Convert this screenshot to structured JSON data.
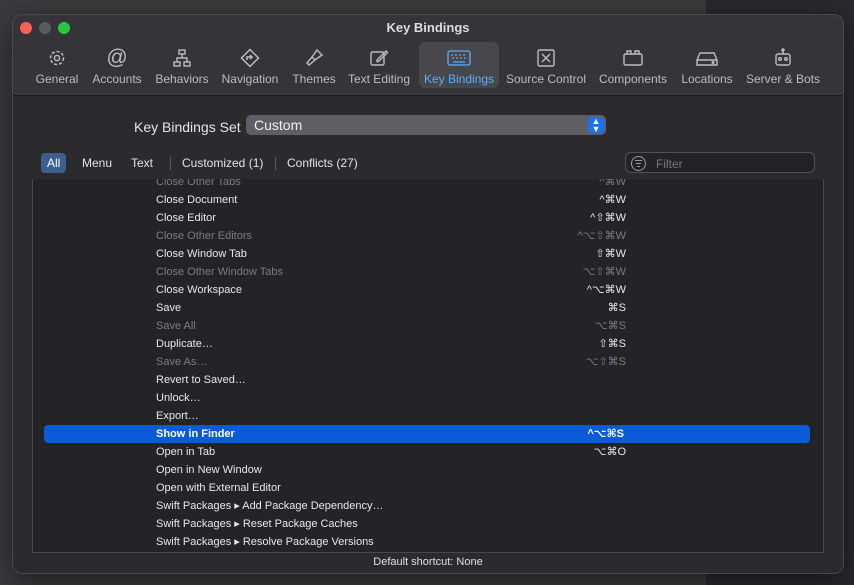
{
  "window": {
    "title": "Key Bindings"
  },
  "toolbar": {
    "tabs": [
      {
        "label": "General",
        "icon": "gear-icon"
      },
      {
        "label": "Accounts",
        "icon": "at-icon"
      },
      {
        "label": "Behaviors",
        "icon": "hierarchy-icon"
      },
      {
        "label": "Navigation",
        "icon": "navigation-diamond-icon"
      },
      {
        "label": "Themes",
        "icon": "paintbrush-icon"
      },
      {
        "label": "Text Editing",
        "icon": "pencil-square-icon"
      },
      {
        "label": "Key Bindings",
        "icon": "keyboard-icon",
        "active": true
      },
      {
        "label": "Source Control",
        "icon": "source-control-icon"
      },
      {
        "label": "Components",
        "icon": "components-box-icon"
      },
      {
        "label": "Locations",
        "icon": "drive-icon"
      },
      {
        "label": "Server & Bots",
        "icon": "robot-icon"
      }
    ]
  },
  "key_bindings_set": {
    "label": "Key Bindings Set",
    "value": "Custom"
  },
  "filter_tabs": {
    "all": "All",
    "menu": "Menu",
    "text": "Text",
    "customized": "Customized (1)",
    "conflicts": "Conflicts (27)"
  },
  "filter": {
    "placeholder": "Filter"
  },
  "bindings": [
    {
      "command": "Close Other Tabs",
      "shortcut": "^⌘W",
      "dim": true
    },
    {
      "command": "Close Document",
      "shortcut": "^⌘W"
    },
    {
      "command": "Close Editor",
      "shortcut": "^⇧⌘W"
    },
    {
      "command": "Close Other Editors",
      "shortcut": "^⌥⇧⌘W",
      "dim": true
    },
    {
      "command": "Close Window Tab",
      "shortcut": "⇧⌘W"
    },
    {
      "command": "Close Other Window Tabs",
      "shortcut": "⌥⇧⌘W",
      "dim": true
    },
    {
      "command": "Close Workspace",
      "shortcut": "^⌥⌘W"
    },
    {
      "command": "Save",
      "shortcut": "⌘S"
    },
    {
      "command": "Save All",
      "shortcut": "⌥⌘S",
      "dim": true
    },
    {
      "command": "Duplicate…",
      "shortcut": "⇧⌘S"
    },
    {
      "command": "Save As…",
      "shortcut": "⌥⇧⌘S",
      "dim": true
    },
    {
      "command": "Revert to Saved…",
      "shortcut": ""
    },
    {
      "command": "Unlock…",
      "shortcut": ""
    },
    {
      "command": "Export…",
      "shortcut": ""
    },
    {
      "command": "Show in Finder",
      "shortcut": "^⌥⌘S",
      "selected": true
    },
    {
      "command": "Open in Tab",
      "shortcut": "⌥⌘O"
    },
    {
      "command": "Open in New Window",
      "shortcut": ""
    },
    {
      "command": "Open with External Editor",
      "shortcut": ""
    },
    {
      "command": "Swift Packages ▸ Add Package Dependency…",
      "shortcut": ""
    },
    {
      "command": "Swift Packages ▸ Reset Package Caches",
      "shortcut": ""
    },
    {
      "command": "Swift Packages ▸ Resolve Package Versions",
      "shortcut": ""
    }
  ],
  "footer": {
    "default_shortcut": "Default shortcut: None"
  }
}
